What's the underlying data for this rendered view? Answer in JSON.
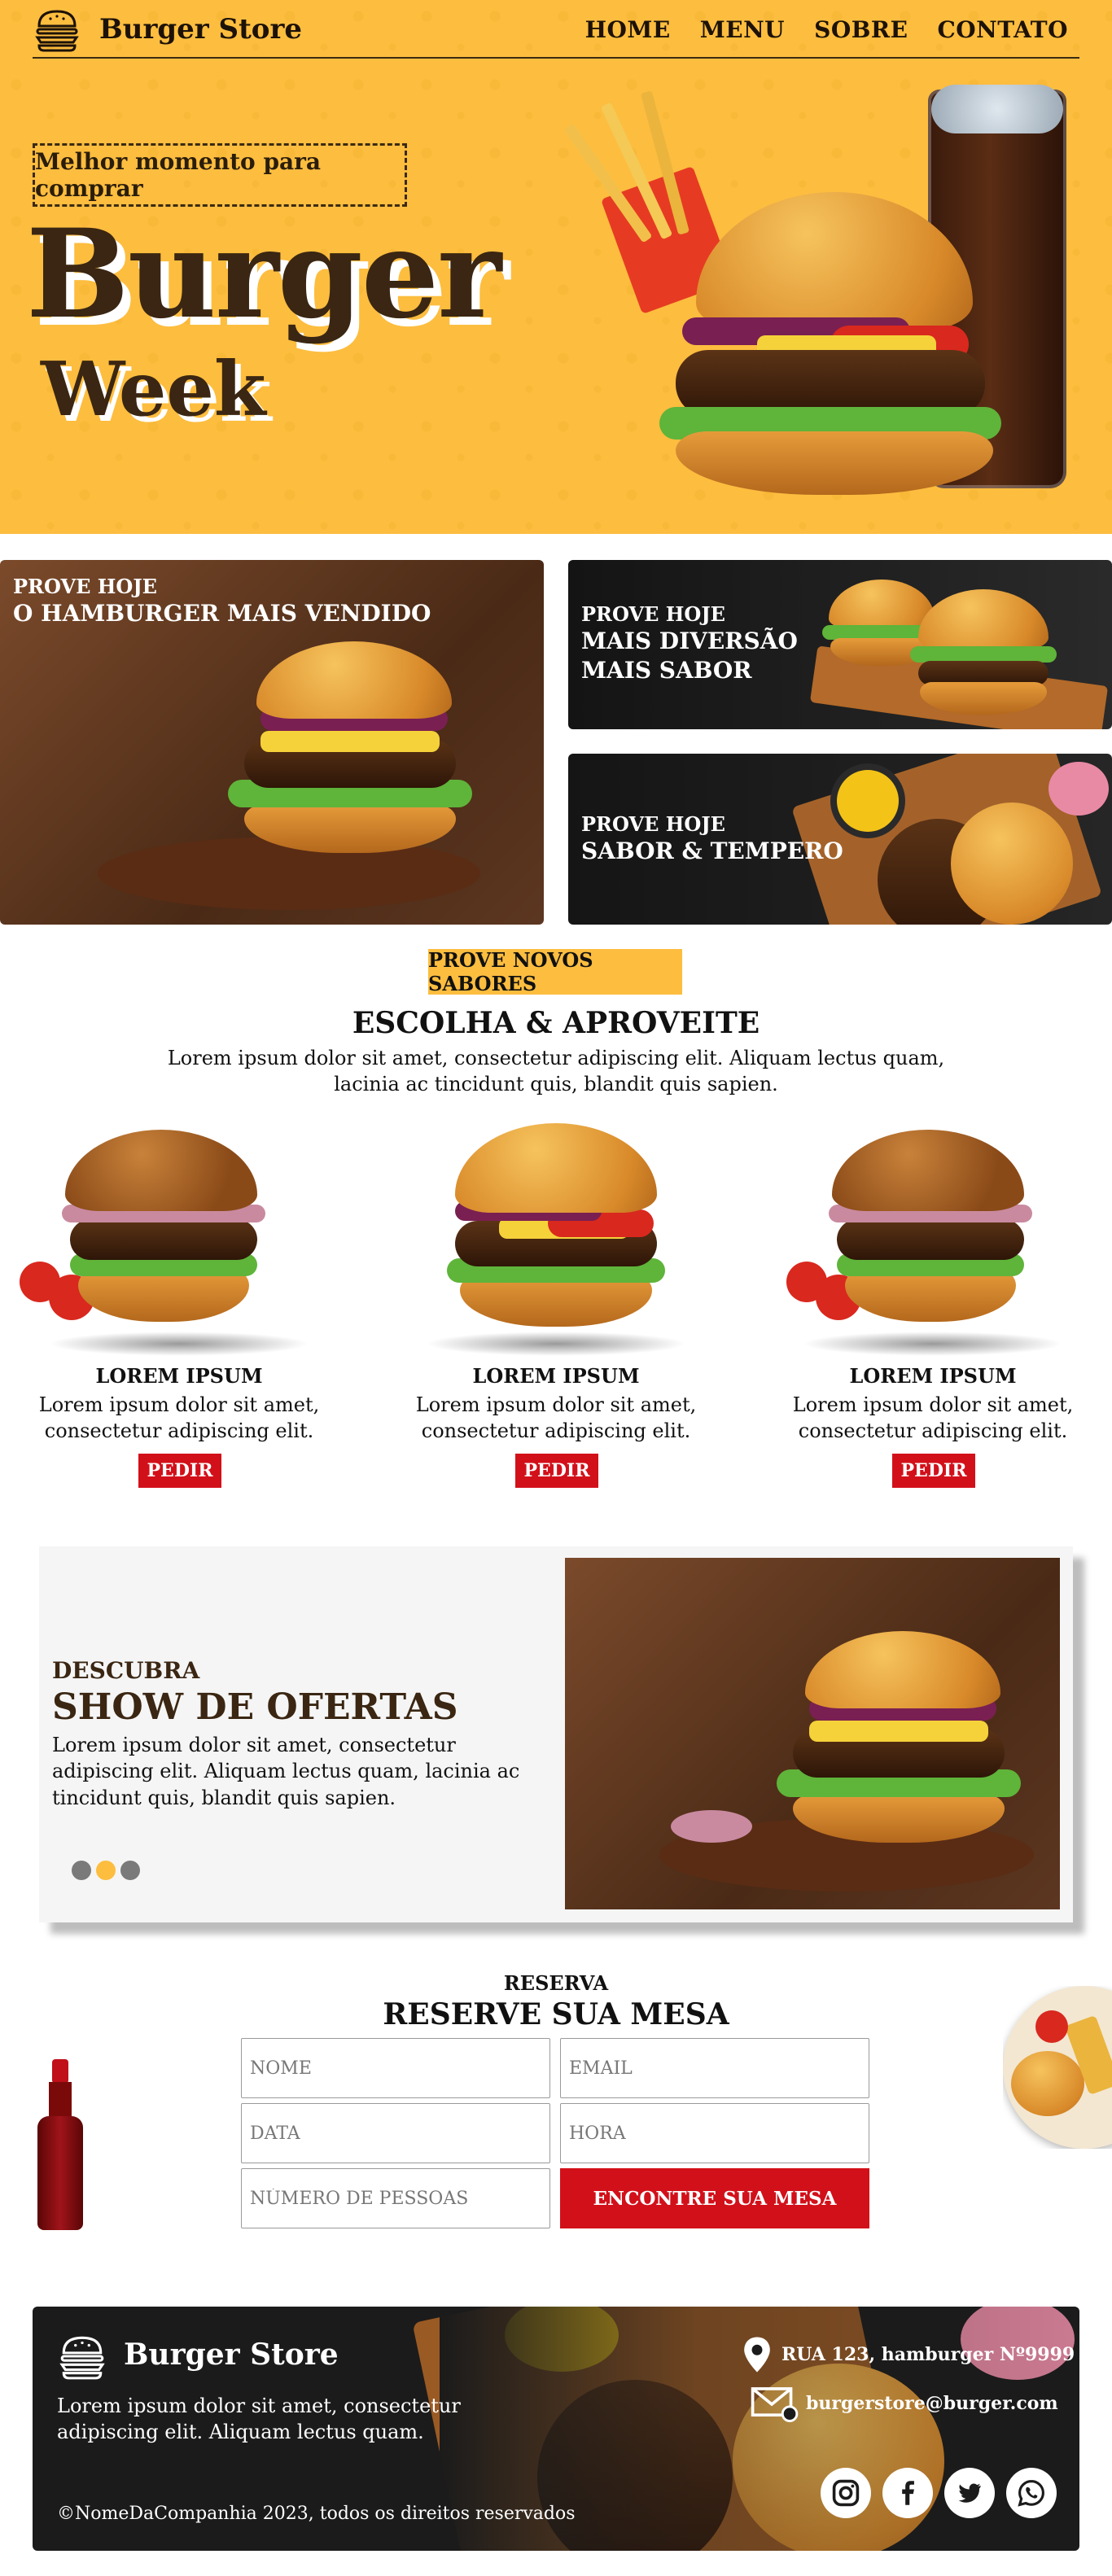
{
  "header": {
    "brand": "Burger Store",
    "menu": [
      "HOME",
      "MENU",
      "SOBRE",
      "CONTATO"
    ]
  },
  "hero": {
    "badge": "Melhor momento para comprar",
    "title_line1": "Burger",
    "title_line2": "Week"
  },
  "promo_cards": [
    {
      "kicker": "PROVE HOJE",
      "title": "O HAMBURGER MAIS VENDIDO"
    },
    {
      "kicker": "PROVE HOJE",
      "title_line1": "MAIS DIVERSÃO",
      "title_line2": "MAIS SABOR"
    },
    {
      "kicker": "PROVE HOJE",
      "title": "SABOR & TEMPERO"
    }
  ],
  "section": {
    "tag": "PROVE NOVOS SABORES",
    "title": "ESCOLHA & APROVEITE",
    "description": "Lorem ipsum dolor sit amet, consectetur adipiscing elit. Aliquam lectus quam, lacinia ac tincidunt quis, blandit quis sapien."
  },
  "products": [
    {
      "name": "LOREM IPSUM",
      "desc": "Lorem ipsum dolor sit amet, consectetur adipiscing elit.",
      "button": "PEDIR"
    },
    {
      "name": "LOREM IPSUM",
      "desc": "Lorem ipsum dolor sit amet, consectetur adipiscing elit.",
      "button": "PEDIR"
    },
    {
      "name": "LOREM IPSUM",
      "desc": "Lorem ipsum dolor sit amet, consectetur adipiscing elit.",
      "button": "PEDIR"
    }
  ],
  "offers": {
    "kicker": "DESCUBRA",
    "title": "SHOW DE OFERTAS",
    "description": "Lorem ipsum dolor sit amet, consectetur adipiscing elit. Aliquam lectus quam, lacinia ac tincidunt quis, blandit quis sapien.",
    "active_dot": 2
  },
  "reservation": {
    "kicker": "RESERVA",
    "title": "RESERVE SUA MESA",
    "placeholders": {
      "name": "NOME",
      "email": "EMAIL",
      "date": "DATA",
      "time": "HORA",
      "people": "NÚMERO DE PESSOAS"
    },
    "button": "ENCONTRE SUA MESA"
  },
  "footer": {
    "brand": "Burger Store",
    "description": "Lorem ipsum dolor sit amet, consectetur adipiscing elit. Aliquam lectus quam.",
    "copyright": "©NomeDaCompanhia 2023, todos os direitos reservados",
    "address": "RUA 123, hamburger Nº9999",
    "email": "burgerstore@burger.com",
    "social": [
      "instagram-icon",
      "facebook-icon",
      "twitter-icon",
      "whatsapp-icon"
    ]
  },
  "colors": {
    "accent": "#fdbd3f",
    "button": "#d2101a",
    "dark": "#1b1b1b",
    "brown": "#3a2612"
  }
}
